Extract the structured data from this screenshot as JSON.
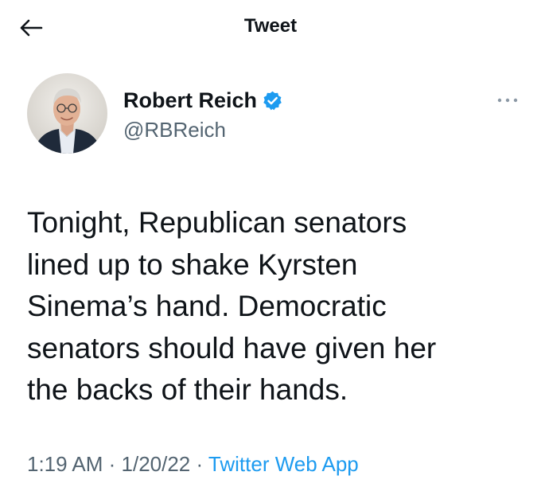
{
  "header": {
    "title": "Tweet",
    "back_icon": "arrow-left-icon"
  },
  "author": {
    "name": "Robert Reich",
    "handle": "@RBReich",
    "verified": true,
    "verified_icon": "verified-badge-icon",
    "avatar_icon": "avatar-photo"
  },
  "more_icon": "more-dots-icon",
  "tweet": {
    "text": "Tonight, Republican senators\nlined up to shake Kyrsten\nSinema’s hand. Democratic\nsenators should have given her\nthe backs of their hands."
  },
  "meta": {
    "time": "1:19 AM",
    "sep1": " · ",
    "date": "1/20/22",
    "sep2": " · ",
    "source": "Twitter Web App"
  },
  "colors": {
    "text": "#0f1419",
    "secondary": "#536471",
    "accent": "#1d9bf0"
  }
}
